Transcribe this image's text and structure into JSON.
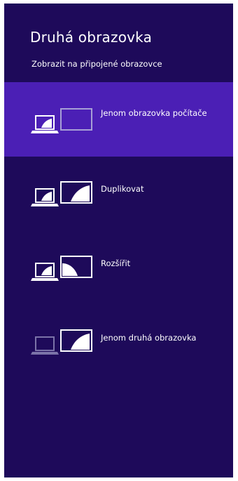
{
  "panel": {
    "title": "Druhá obrazovka",
    "subtitle": "Zobrazit na připojené obrazovce",
    "colors": {
      "background": "#1e0a5a",
      "selected": "#4b1fb5",
      "text": "#ffffff",
      "inactive_laptop": "#7b73a8",
      "inactive_screen": "#a79fd6"
    }
  },
  "options": [
    {
      "label": "Jenom obrazovka počítače",
      "icon": "pc-screen-only-icon",
      "selected": true
    },
    {
      "label": "Duplikovat",
      "icon": "duplicate-icon",
      "selected": false
    },
    {
      "label": "Rozšířit",
      "icon": "extend-icon",
      "selected": false
    },
    {
      "label": "Jenom druhá obrazovka",
      "icon": "second-screen-only-icon",
      "selected": false
    }
  ]
}
